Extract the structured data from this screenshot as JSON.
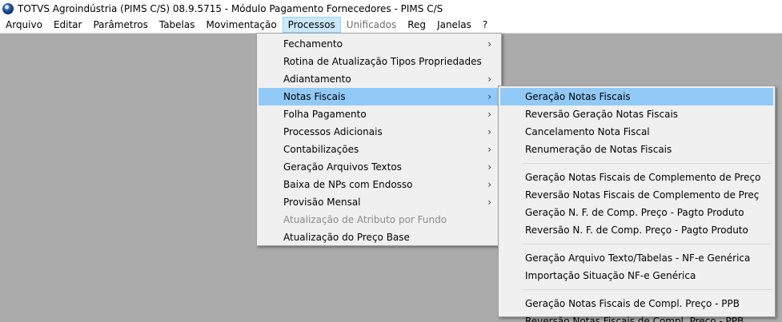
{
  "window": {
    "title": "TOTVS Agroindústria (PIMS C/S) 08.9.5715 - Módulo Pagamento Fornecedores - PIMS C/S",
    "icon": "app-globe-icon"
  },
  "menubar": [
    {
      "label": "Arquivo"
    },
    {
      "label": "Editar"
    },
    {
      "label": "Parâmetros"
    },
    {
      "label": "Tabelas"
    },
    {
      "label": "Movimentação"
    },
    {
      "label": "Processos",
      "open": true
    },
    {
      "label": "Unificados",
      "disabled": true
    },
    {
      "label": "Reg"
    },
    {
      "label": "Janelas"
    },
    {
      "label": "?"
    }
  ],
  "processos_menu": [
    {
      "label": "Fechamento",
      "submenu": true
    },
    {
      "label": "Rotina de Atualização Tipos Propriedades"
    },
    {
      "label": "Adiantamento",
      "submenu": true
    },
    {
      "label": "Notas Fiscais",
      "submenu": true,
      "highlight": true
    },
    {
      "label": "Folha Pagamento",
      "submenu": true
    },
    {
      "label": "Processos Adicionais",
      "submenu": true
    },
    {
      "label": "Contabilizações",
      "submenu": true
    },
    {
      "label": "Geração Arquivos Textos",
      "submenu": true
    },
    {
      "label": "Baixa de NPs com Endosso",
      "submenu": true
    },
    {
      "label": "Provisão Mensal",
      "submenu": true
    },
    {
      "label": "Atualização de Atributo por Fundo",
      "disabled": true
    },
    {
      "label": "Atualização do Preço Base"
    }
  ],
  "notas_fiscais_submenu": [
    {
      "label": "Geração Notas Fiscais",
      "highlight": true
    },
    {
      "label": "Reversão Geração Notas Fiscais"
    },
    {
      "label": "Cancelamento Nota Fiscal"
    },
    {
      "label": "Renumeração de Notas Fiscais"
    },
    {
      "separator": true
    },
    {
      "label": "Geração Notas Fiscais de Complemento de Preço"
    },
    {
      "label": "Reversão Notas Fiscais de Complemento de Preç"
    },
    {
      "label": "Geração N. F. de Comp. Preço - Pagto Produto"
    },
    {
      "label": "Reversão N. F. de Comp. Preço - Pagto Produto"
    },
    {
      "separator": true
    },
    {
      "label": "Geração Arquivo Texto/Tabelas - NF-e Genérica"
    },
    {
      "label": "Importação Situação NF-e Genérica"
    },
    {
      "separator": true
    },
    {
      "label": "Geração Notas Fiscais de Compl. Preço - PPB"
    },
    {
      "label": "Reversão Notas Fiscais de Compl. Preço - PPB"
    }
  ],
  "icons": {
    "submenu_arrow": "›"
  },
  "colors": {
    "workspace": "#ababab",
    "highlight": "#91c9f7",
    "menubar_open": "#cce8ff",
    "menu_background": "#f0f0f0"
  }
}
